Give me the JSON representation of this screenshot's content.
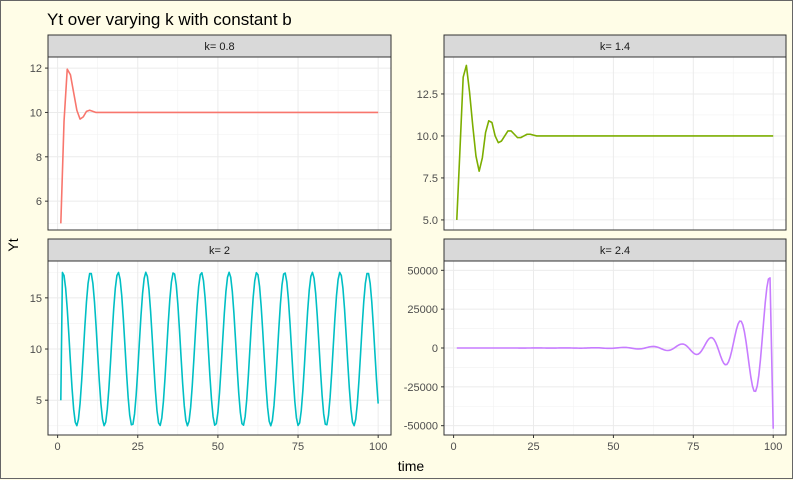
{
  "colors": {
    "series": [
      "#f8766d",
      "#7cae00",
      "#00bfc4",
      "#c77cff"
    ]
  },
  "chart_data": {
    "type": "line",
    "title": "Yt over varying k with constant b",
    "xlabel": "time",
    "ylabel": "Yt",
    "grid": true,
    "panels": [
      {
        "strip": "k= 0.8",
        "color": "#f8766d",
        "xlim": [
          -3,
          104
        ],
        "ylim": [
          4.7,
          12.5
        ],
        "xticks": [
          0,
          25,
          50,
          75,
          100
        ],
        "yticks": [
          6,
          8,
          10,
          12
        ],
        "ytick_labels": [
          "6",
          "8",
          "10",
          "12"
        ],
        "x": [
          1,
          2,
          3,
          4,
          5,
          6,
          7,
          8,
          9,
          10,
          11,
          12,
          13,
          14,
          15,
          100
        ],
        "y": [
          5.0,
          9.6,
          11.95,
          11.7,
          10.9,
          10.1,
          9.7,
          9.8,
          10.05,
          10.1,
          10.05,
          10.0,
          10.0,
          10.0,
          10.0,
          10.0
        ]
      },
      {
        "strip": "k= 1.4",
        "color": "#7cae00",
        "xlim": [
          -3,
          104
        ],
        "ylim": [
          4.4,
          14.7
        ],
        "xticks": [
          0,
          25,
          50,
          75,
          100
        ],
        "yticks": [
          5.0,
          7.5,
          10.0,
          12.5
        ],
        "ytick_labels": [
          "5.0",
          "7.5",
          "10.0",
          "12.5"
        ],
        "x": [
          1,
          2,
          3,
          4,
          5,
          6,
          7,
          8,
          9,
          10,
          11,
          12,
          13,
          14,
          15,
          16,
          17,
          18,
          19,
          20,
          21,
          22,
          23,
          24,
          25,
          26,
          27,
          28,
          29,
          30,
          100
        ],
        "y": [
          5.0,
          9.2,
          13.5,
          14.2,
          12.6,
          10.6,
          8.8,
          7.9,
          8.7,
          10.2,
          10.9,
          10.8,
          10.0,
          9.6,
          9.7,
          10.0,
          10.3,
          10.3,
          10.1,
          9.9,
          9.9,
          10.0,
          10.1,
          10.1,
          10.05,
          10.0,
          10.0,
          10.0,
          10.0,
          10.0,
          10.0
        ]
      },
      {
        "strip": "k= 2",
        "color": "#00bfc4",
        "xlim": [
          -3,
          104
        ],
        "ylim": [
          1.6,
          18.6
        ],
        "xticks": [
          0,
          25,
          50,
          75,
          100
        ],
        "yticks": [
          5,
          10,
          15
        ],
        "ytick_labels": [
          "5",
          "10",
          "15"
        ],
        "period": 8.65,
        "phase": 1.6,
        "center": 10,
        "amplitude": 7.5
      },
      {
        "strip": "k= 2.4",
        "color": "#c77cff",
        "xlim": [
          -3,
          104
        ],
        "ylim": [
          -56000,
          56000
        ],
        "xticks": [
          0,
          25,
          50,
          75,
          100
        ],
        "yticks": [
          -50000,
          -25000,
          0,
          25000,
          50000
        ],
        "ytick_labels": [
          "-50000",
          "-25000",
          "0",
          "25000",
          "50000"
        ],
        "period": 9.1,
        "peak": 45000,
        "peak_x": 98.6,
        "growth": 0.105,
        "end_value": -52000
      }
    ],
    "xtick_labels": [
      "0",
      "25",
      "50",
      "75",
      "100"
    ]
  }
}
